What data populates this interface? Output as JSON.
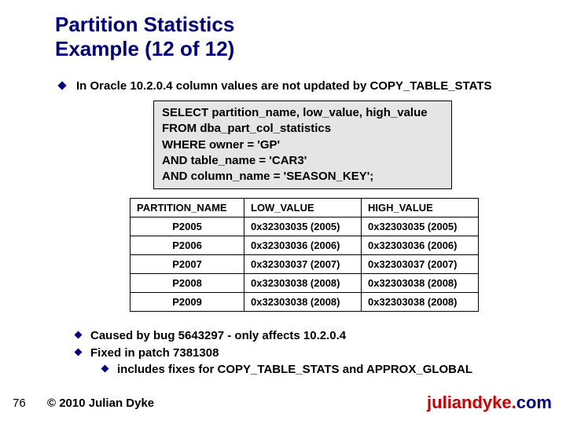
{
  "title_line1": "Partition Statistics",
  "title_line2": "Example (12 of 12)",
  "bullet_main": "In Oracle 10.2.0.4 column values are not updated by COPY_TABLE_STATS",
  "sql": {
    "l1": "SELECT partition_name, low_value, high_value",
    "l2": "FROM dba_part_col_statistics",
    "l3": "WHERE owner = 'GP'",
    "l4": "AND table_name = 'CAR3'",
    "l5": "AND column_name = 'SEASON_KEY';"
  },
  "table": {
    "headers": {
      "c1": "PARTITION_NAME",
      "c2": "LOW_VALUE",
      "c3": "HIGH_VALUE"
    },
    "rows": [
      {
        "c1": "P2005",
        "c2": "0x32303035 (2005)",
        "c3": "0x32303035 (2005)"
      },
      {
        "c1": "P2006",
        "c2": "0x32303036 (2006)",
        "c3": "0x32303036 (2006)"
      },
      {
        "c1": "P2007",
        "c2": "0x32303037 (2007)",
        "c3": "0x32303037 (2007)"
      },
      {
        "c1": "P2008",
        "c2": "0x32303038 (2008)",
        "c3": "0x32303038 (2008)"
      },
      {
        "c1": "P2009",
        "c2": "0x32303038 (2008)",
        "c3": "0x32303038 (2008)"
      }
    ]
  },
  "bullets": {
    "b1": "Caused by bug 5643297 - only affects 10.2.0.4",
    "b2": "Fixed in patch 7381308",
    "b3": "includes fixes for COPY_TABLE_STATS and APPROX_GLOBAL"
  },
  "page_number": "76",
  "copyright": "© 2010 Julian Dyke",
  "site_main": "juliandyke.",
  "site_tld": "com"
}
